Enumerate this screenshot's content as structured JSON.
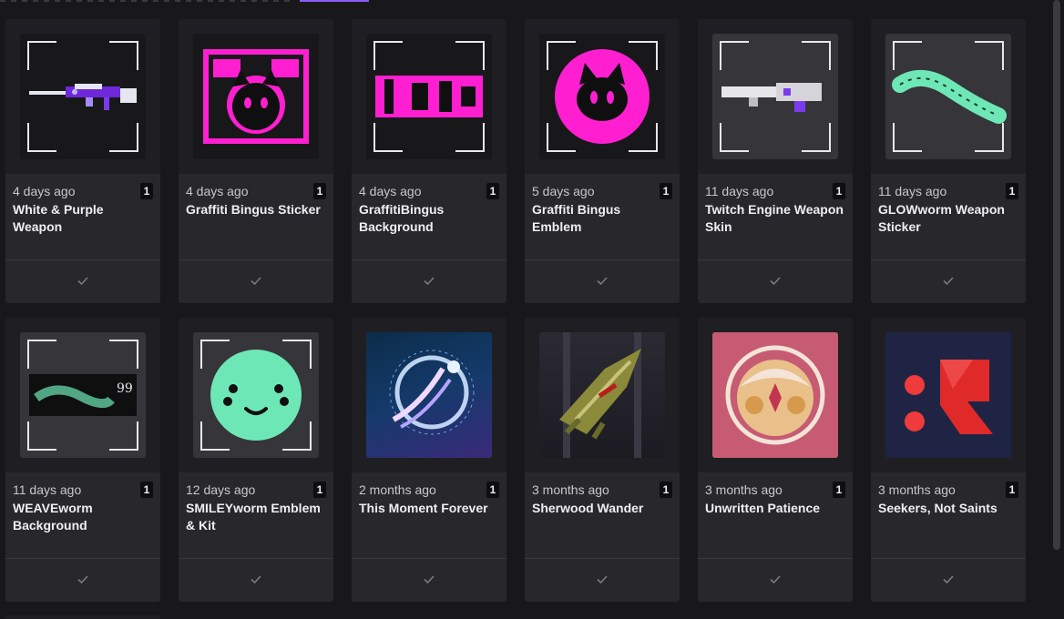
{
  "items": [
    {
      "date": "4 days ago",
      "qty": "1",
      "title": "White & Purple Weapon",
      "thumb": "weapon-white-purple"
    },
    {
      "date": "4 days ago",
      "qty": "1",
      "title": "Graffiti Bingus Sticker",
      "thumb": "graffiti-sticker"
    },
    {
      "date": "4 days ago",
      "qty": "1",
      "title": "GraffitiBingus Background",
      "thumb": "graffiti-background"
    },
    {
      "date": "5 days ago",
      "qty": "1",
      "title": "Graffiti Bingus Emblem",
      "thumb": "graffiti-emblem"
    },
    {
      "date": "11 days ago",
      "qty": "1",
      "title": "Twitch Engine Weapon Skin",
      "thumb": "weapon-twitch-engine"
    },
    {
      "date": "11 days ago",
      "qty": "1",
      "title": "GLOWworm Weapon Sticker",
      "thumb": "glowworm-sticker"
    },
    {
      "date": "11 days ago",
      "qty": "1",
      "title": "WEAVEworm Background",
      "thumb": "weaveworm-background"
    },
    {
      "date": "12 days ago",
      "qty": "1",
      "title": "SMILEYworm Emblem & Kit",
      "thumb": "smileyworm-emblem"
    },
    {
      "date": "2 months ago",
      "qty": "1",
      "title": "This Moment Forever",
      "thumb": "moment-forever"
    },
    {
      "date": "3 months ago",
      "qty": "1",
      "title": "Sherwood Wander",
      "thumb": "sherwood-wander"
    },
    {
      "date": "3 months ago",
      "qty": "1",
      "title": "Unwritten Patience",
      "thumb": "unwritten-patience"
    },
    {
      "date": "3 months ago",
      "qty": "1",
      "title": "Seekers, Not Saints",
      "thumb": "seekers-not-saints"
    }
  ],
  "badge": {
    "weaveworm_number": "99"
  },
  "colors": {
    "background": "#18181b",
    "card": "#27272c",
    "text": "#efeff1",
    "accent": "#8c5cf7",
    "magenta": "#ff1fd1",
    "mint": "#6ee7b7"
  }
}
